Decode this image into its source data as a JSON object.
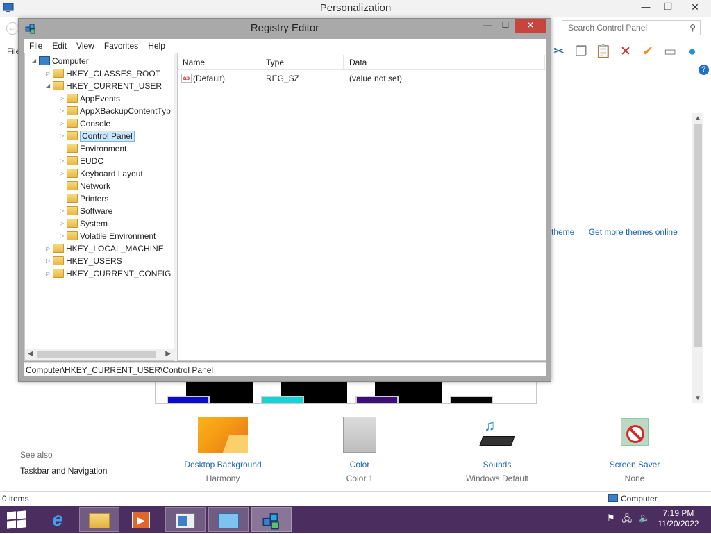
{
  "personalization": {
    "title": "Personalization",
    "window_buttons": {
      "minimize": "—",
      "maximize": "❐",
      "close": "✕"
    },
    "search_placeholder": "Search Control Panel",
    "file_menu": "File",
    "toolbar_icons": [
      "cut-icon",
      "copy-icon",
      "paste-icon",
      "delete-icon",
      "check-icon",
      "rename-icon",
      "globe-icon"
    ],
    "themes_links": [
      "theme",
      "Get more themes online"
    ],
    "see_also": {
      "heading": "See also",
      "link": "Taskbar and Navigation"
    },
    "items": [
      {
        "label": "Desktop Background",
        "sub": "Harmony"
      },
      {
        "label": "Color",
        "sub": "Color 1"
      },
      {
        "label": "Sounds",
        "sub": "Windows Default"
      },
      {
        "label": "Screen Saver",
        "sub": "None"
      }
    ],
    "status": {
      "left": "0 items",
      "right": "Computer"
    },
    "theme_swatch_colors": [
      "#0a0ad0",
      "#14d4d4",
      "#3a0f78",
      "#050505"
    ]
  },
  "registry": {
    "title": "Registry Editor",
    "window_buttons": {
      "minimize": "—",
      "maximize": "☐",
      "close": "✕"
    },
    "menu": [
      "File",
      "Edit",
      "View",
      "Favorites",
      "Help"
    ],
    "tree": [
      {
        "label": "Computer",
        "level": 0,
        "expander": "◢"
      },
      {
        "label": "HKEY_CLASSES_ROOT",
        "level": 1,
        "expander": "▷"
      },
      {
        "label": "HKEY_CURRENT_USER",
        "level": 1,
        "expander": "◢"
      },
      {
        "label": "AppEvents",
        "level": 2,
        "expander": "▷"
      },
      {
        "label": "AppXBackupContentTyp",
        "level": 2,
        "expander": "▷"
      },
      {
        "label": "Console",
        "level": 2,
        "expander": "▷"
      },
      {
        "label": "Control Panel",
        "level": 2,
        "expander": "▷",
        "selected": true
      },
      {
        "label": "Environment",
        "level": 2,
        "expander": ""
      },
      {
        "label": "EUDC",
        "level": 2,
        "expander": "▷"
      },
      {
        "label": "Keyboard Layout",
        "level": 2,
        "expander": "▷"
      },
      {
        "label": "Network",
        "level": 2,
        "expander": ""
      },
      {
        "label": "Printers",
        "level": 2,
        "expander": ""
      },
      {
        "label": "Software",
        "level": 2,
        "expander": "▷"
      },
      {
        "label": "System",
        "level": 2,
        "expander": "▷"
      },
      {
        "label": "Volatile Environment",
        "level": 2,
        "expander": "▷"
      },
      {
        "label": "HKEY_LOCAL_MACHINE",
        "level": 1,
        "expander": "▷"
      },
      {
        "label": "HKEY_USERS",
        "level": 1,
        "expander": "▷"
      },
      {
        "label": "HKEY_CURRENT_CONFIG",
        "level": 1,
        "expander": "▷"
      }
    ],
    "columns": [
      "Name",
      "Type",
      "Data"
    ],
    "values": [
      {
        "name": "(Default)",
        "type": "REG_SZ",
        "data": "(value not set)"
      }
    ],
    "status_path": "Computer\\HKEY_CURRENT_USER\\Control Panel"
  },
  "taskbar": {
    "apps": [
      "internet-explorer-icon",
      "file-explorer-icon",
      "media-player-icon",
      "control-panel-icon",
      "remote-desktop-icon",
      "registry-editor-icon"
    ],
    "tray_icons": [
      "flag-icon",
      "network-icon",
      "volume-icon"
    ],
    "time": "7:19 PM",
    "date": "11/20/2022"
  }
}
